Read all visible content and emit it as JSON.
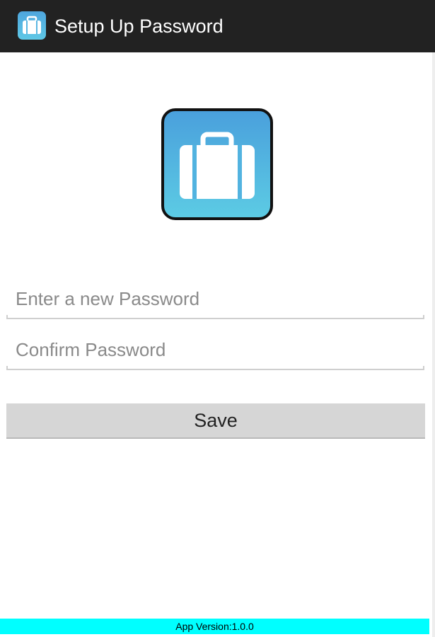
{
  "action_bar": {
    "title": "Setup Up Password",
    "icon": "briefcase-icon"
  },
  "logo": {
    "icon": "briefcase-icon",
    "colors": {
      "top": "#4aa0dc",
      "bottom": "#5ccbe4",
      "border": "#111111"
    }
  },
  "form": {
    "new_password": {
      "value": "",
      "placeholder": "Enter a new Password"
    },
    "confirm_password": {
      "value": "",
      "placeholder": "Confirm Password"
    },
    "save_label": "Save"
  },
  "footer": {
    "version_text": "App Version:1.0.0",
    "color": "#00ffff"
  },
  "colors": {
    "action_bar": "#222222",
    "button": "#d6d6d6"
  }
}
